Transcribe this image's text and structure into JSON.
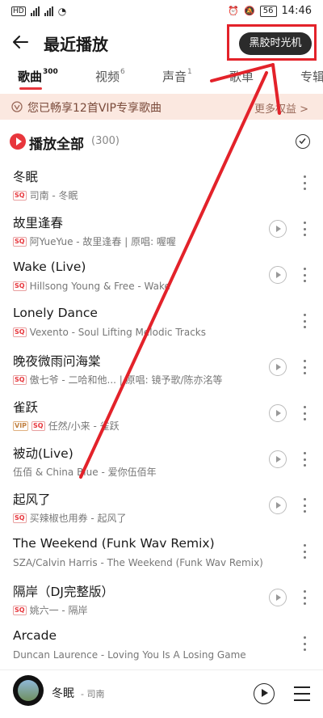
{
  "status_bar": {
    "left": "HD 2 26 46",
    "battery": "56",
    "time": "14:46"
  },
  "header": {
    "title": "最近播放",
    "vinyl_button": "黑胶时光机"
  },
  "tabs": [
    {
      "label": "歌曲",
      "count": "300"
    },
    {
      "label": "视频",
      "count": "6"
    },
    {
      "label": "声音",
      "count": "1"
    },
    {
      "label": "歌单",
      "count": ""
    },
    {
      "label": "专辑",
      "count": ""
    }
  ],
  "vip_banner": {
    "text": "您已畅享12首VIP专享歌曲",
    "more": "更多权益 >"
  },
  "play_all": {
    "label": "播放全部",
    "count": "(300)"
  },
  "songs": [
    {
      "title": "冬眠",
      "badge": "SQ",
      "subtitle": "司南 - 冬眠",
      "has_mv": false
    },
    {
      "title": "故里逢春",
      "badge": "SQ",
      "subtitle": "阿YueYue - 故里逢春 | 原唱: 喔喔",
      "has_mv": true
    },
    {
      "title": "Wake (Live)",
      "badge": "SQ",
      "subtitle": "Hillsong Young & Free - Wake",
      "has_mv": true
    },
    {
      "title": "Lonely Dance",
      "badge": "SQ",
      "subtitle": "Vexento - Soul Lifting Melodic Tracks",
      "has_mv": false
    },
    {
      "title": "晚夜微雨问海棠",
      "badge": "SQ",
      "subtitle": "傲七爷 - 二哈和他... | 原唱: 镜予歌/陈亦洺等",
      "has_mv": true
    },
    {
      "title": "雀跃",
      "badge": "VIP SQ",
      "subtitle": "任然/小来 - 雀跃",
      "has_mv": true
    },
    {
      "title": "被动(Live)",
      "badge": "",
      "subtitle": "伍佰 & China Blue - 爱你伍佰年",
      "has_mv": true
    },
    {
      "title": "起风了",
      "badge": "SQ",
      "subtitle": "买辣椒也用券 - 起风了",
      "has_mv": true
    },
    {
      "title": "The Weekend (Funk Wav Remix)",
      "badge": "",
      "subtitle": "SZA/Calvin Harris - The Weekend (Funk Wav Remix)",
      "has_mv": false
    },
    {
      "title": "隔岸（DJ完整版）",
      "badge": "SQ",
      "subtitle": "姚六一 - 隔岸",
      "has_mv": true
    },
    {
      "title": "Arcade",
      "badge": "",
      "subtitle": "Duncan Laurence - Loving You Is A Losing Game",
      "has_mv": false
    }
  ],
  "now_playing": {
    "title": "冬眠",
    "artist": "- 司南"
  },
  "colors": {
    "accent": "#e8363c",
    "annotation": "#e3222a"
  }
}
